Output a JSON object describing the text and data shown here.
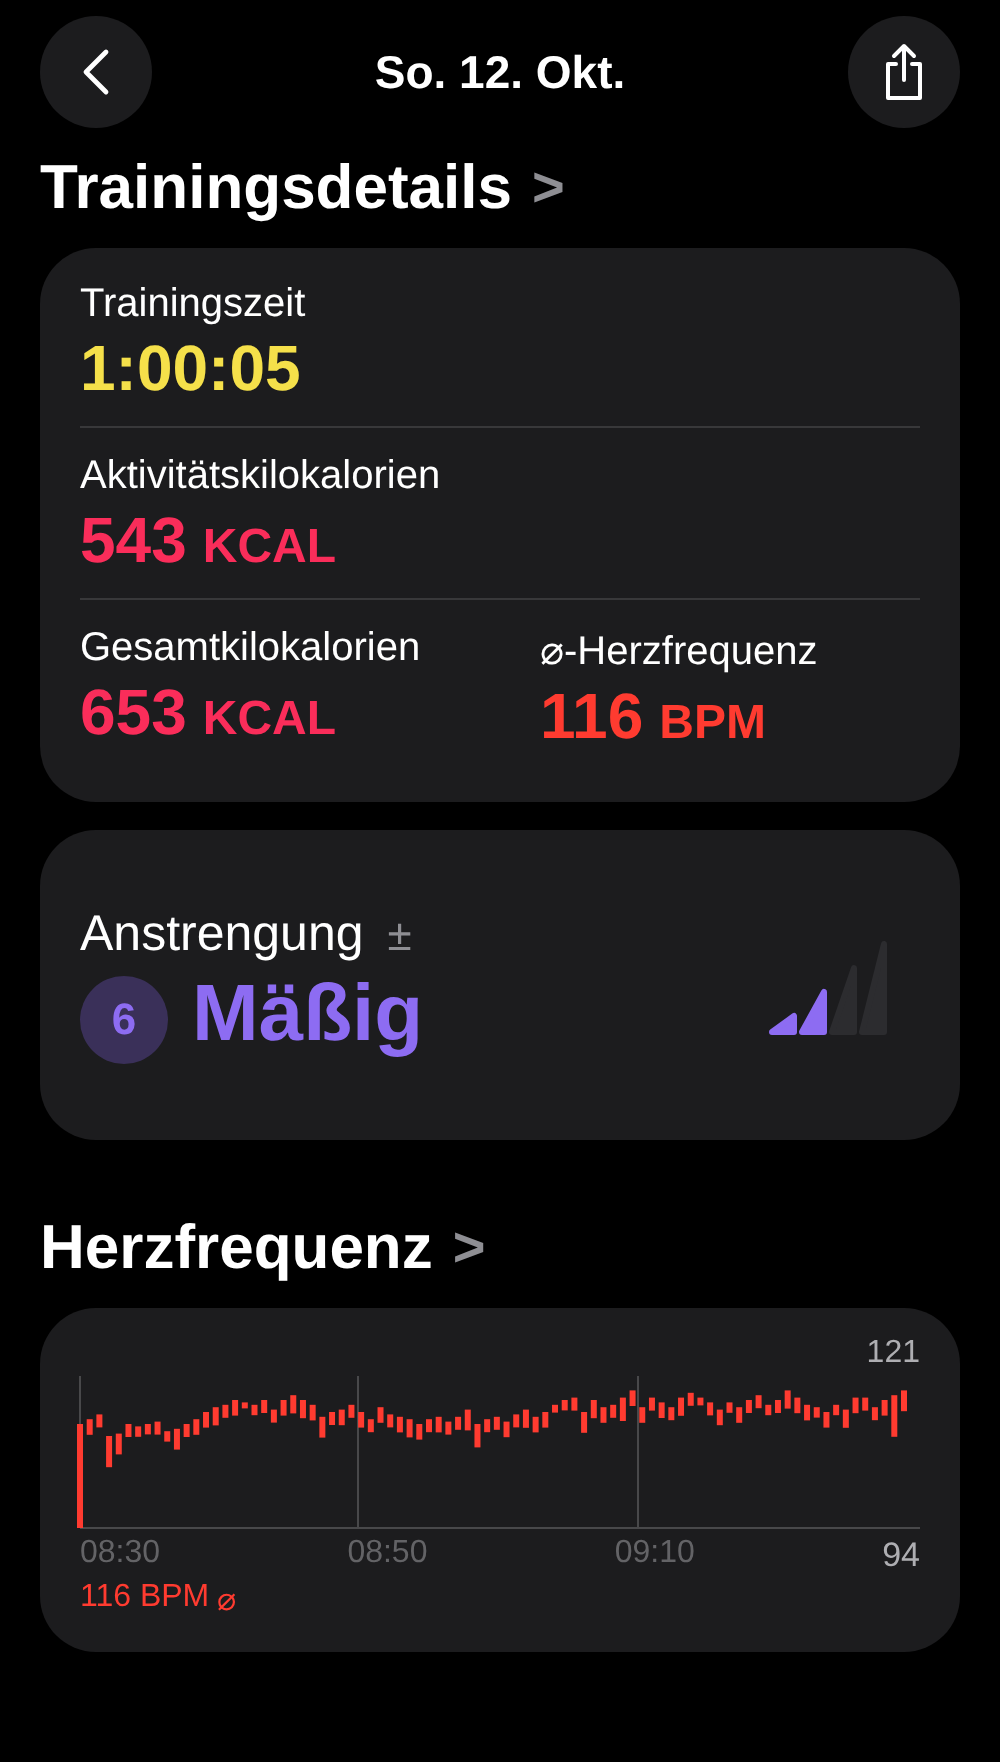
{
  "nav": {
    "title": "So. 12. Okt."
  },
  "details": {
    "heading": "Trainingsdetails",
    "chevron": ">",
    "metrics": [
      {
        "label": "Trainingszeit",
        "value": "1:00:05",
        "color": "#f5e04a"
      },
      {
        "label": "Aktivitätskilokalorien",
        "value": "543",
        "unit": "KCAL",
        "color": "#fa2d5a"
      },
      {
        "label": "Gesamtkilokalorien",
        "value": "653",
        "unit": "KCAL",
        "color": "#fa2d5a"
      },
      {
        "label": "⌀-Herzfrequenz",
        "value": "116",
        "unit": "BPM",
        "color": "#ff3b30"
      }
    ]
  },
  "effort": {
    "label": "Anstrengung",
    "symbol": "±",
    "score": "6",
    "rating": "Mäßig",
    "level": 0.5
  },
  "heart_rate": {
    "heading": "Herzfrequenz",
    "chevron": ">",
    "max_label": "121",
    "min_label": "94",
    "times": [
      "08:30",
      "08:50",
      "09:10"
    ],
    "average": "116 BPM",
    "average_symbol": "⌀"
  }
}
